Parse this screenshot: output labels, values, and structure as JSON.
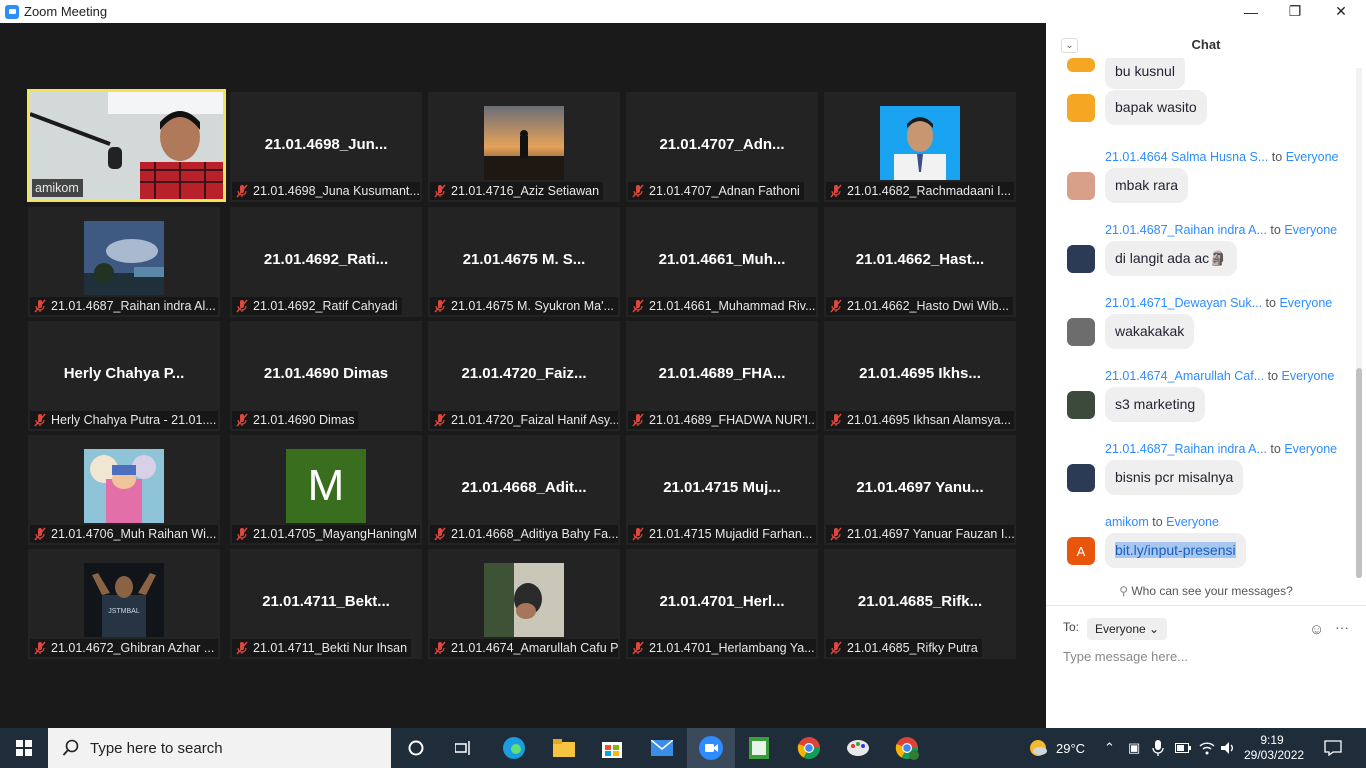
{
  "window": {
    "title": "Zoom Meeting",
    "minimize": "—",
    "maximize": "❐",
    "close": "✕"
  },
  "tiles": [
    {
      "label": "amikom",
      "big": "",
      "active": true
    },
    {
      "label": "21.01.4698_Juna Kusumant...",
      "big": "21.01.4698_Jun..."
    },
    {
      "label": "21.01.4716_Aziz Setiawan",
      "big": ""
    },
    {
      "label": "21.01.4707_Adnan Fathoni",
      "big": "21.01.4707_Adn..."
    },
    {
      "label": "21.01.4682_Rachmadaani I...",
      "big": ""
    },
    {
      "label": "21.01.4687_Raihan indra Al...",
      "big": ""
    },
    {
      "label": "21.01.4692_Ratif Cahyadi",
      "big": "21.01.4692_Rati..."
    },
    {
      "label": "21.01.4675 M. Syukron Ma'...",
      "big": "21.01.4675 M. S..."
    },
    {
      "label": "21.01.4661_Muhammad Riv...",
      "big": "21.01.4661_Muh..."
    },
    {
      "label": "21.01.4662_Hasto Dwi Wib...",
      "big": "21.01.4662_Hast..."
    },
    {
      "label": "Herly Chahya Putra - 21.01....",
      "big": "Herly  Chahya  P..."
    },
    {
      "label": "21.01.4690 Dimas",
      "big": "21.01.4690 Dimas"
    },
    {
      "label": "21.01.4720_Faizal Hanif Asy...",
      "big": "21.01.4720_Faiz..."
    },
    {
      "label": "21.01.4689_FHADWA NUR'I...",
      "big": "21.01.4689_FHA..."
    },
    {
      "label": "21.01.4695 Ikhsan Alamsya...",
      "big": "21.01.4695 Ikhs..."
    },
    {
      "label": "21.01.4706_Muh Raihan Wi...",
      "big": ""
    },
    {
      "label": "21.01.4705_MayangHaningM",
      "big": "",
      "letter": "M"
    },
    {
      "label": "21.01.4668_Aditiya Bahy Fa...",
      "big": "21.01.4668_Adit..."
    },
    {
      "label": "21.01.4715 Mujadid Farhan...",
      "big": "21.01.4715  Muj..."
    },
    {
      "label": "21.01.4697 Yanuar Fauzan I...",
      "big": "21.01.4697 Yanu..."
    },
    {
      "label": "21.01.4672_Ghibran Azhar ...",
      "big": ""
    },
    {
      "label": "21.01.4711_Bekti Nur Ihsan",
      "big": "21.01.4711_Bekt..."
    },
    {
      "label": "21.01.4674_Amarullah Cafu P",
      "big": ""
    },
    {
      "label": "21.01.4701_Herlambang Ya...",
      "big": "21.01.4701_Herl..."
    },
    {
      "label": "21.01.4685_Rifky Putra",
      "big": "21.01.4685_Rifk..."
    }
  ],
  "chat": {
    "title": "Chat",
    "messages": [
      {
        "sender": "",
        "to": "",
        "text": "bu kusnul"
      },
      {
        "sender": "",
        "to": "",
        "text": "bapak wasito"
      },
      {
        "sender": "21.01.4664 Salma Husna S...",
        "to": "Everyone",
        "text": "mbak rara"
      },
      {
        "sender": "21.01.4687_Raihan indra A...",
        "to": "Everyone",
        "text": "di langit ada ac🗿"
      },
      {
        "sender": "21.01.4671_Dewayan Suk...",
        "to": "Everyone",
        "text": "wakakakak"
      },
      {
        "sender": "21.01.4674_Amarullah Caf...",
        "to": "Everyone",
        "text": "s3 marketing"
      },
      {
        "sender": "21.01.4687_Raihan indra A...",
        "to": "Everyone",
        "text": "bisnis pcr misalnya"
      },
      {
        "sender": "amikom",
        "to": "Everyone",
        "text": "bit.ly/input-presensi",
        "avatar_letter": "A"
      }
    ],
    "to_word": "to",
    "who_can_see": "Who can see your messages?",
    "to_label": "To:",
    "to_value": "Everyone",
    "input_placeholder": "Type message here..."
  },
  "taskbar": {
    "search_placeholder": "Type here to search",
    "weather": "29°C",
    "time": "9:19",
    "date": "29/03/2022"
  }
}
